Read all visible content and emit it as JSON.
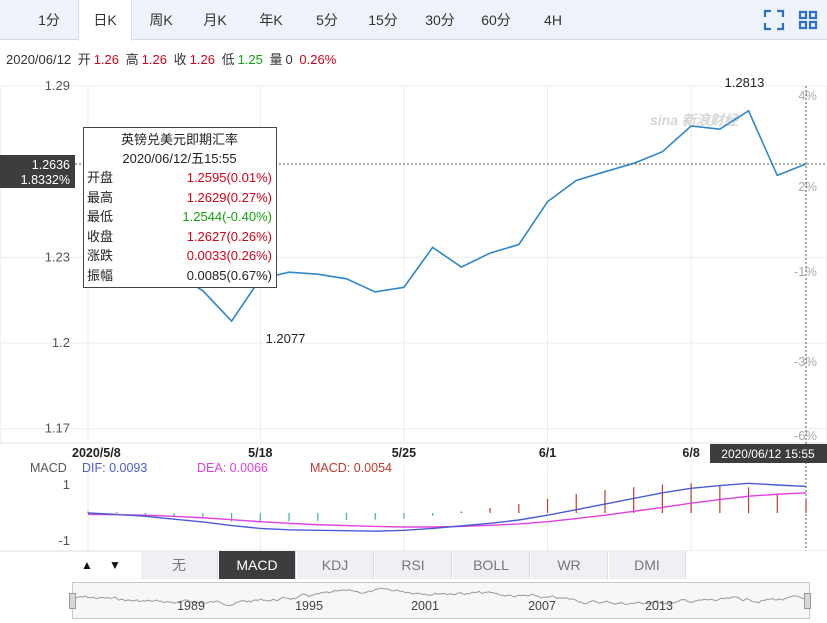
{
  "tabs": [
    "1分",
    "日K",
    "周K",
    "月K",
    "年K",
    "5分",
    "15分",
    "30分",
    "60分",
    "4H"
  ],
  "active_tab": 1,
  "tools": {
    "fullscreen_icon": "fullscreen-icon",
    "layout_icon": "grid-icon"
  },
  "quote": {
    "date": "2020/06/12",
    "open_label": "开",
    "open": "1.26",
    "high_label": "高",
    "high": "1.26",
    "close_label": "收",
    "close": "1.26",
    "low_label": "低",
    "low": "1.25",
    "volume_label": "量",
    "volume": "0",
    "change_pct": "0.26%"
  },
  "watermark": "sina 新浪财经",
  "tooltip": {
    "title": "英镑兑美元即期汇率",
    "datetime": "2020/06/12/五15:55",
    "rows": [
      {
        "label": "开盘",
        "value": "1.2595(0.01%)",
        "color": "red"
      },
      {
        "label": "最高",
        "value": "1.2629(0.27%)",
        "color": "red"
      },
      {
        "label": "最低",
        "value": "1.2544(-0.40%)",
        "color": "green"
      },
      {
        "label": "收盘",
        "value": "1.2627(0.26%)",
        "color": "red"
      },
      {
        "label": "涨跌",
        "value": "0.0033(0.26%)",
        "color": "red"
      },
      {
        "label": "振幅",
        "value": "0.0085(0.67%)",
        "color": "black"
      }
    ]
  },
  "crosshair": {
    "price": "1.2636",
    "pct": "1.8332%",
    "time": "2020/06/12 15:55"
  },
  "colors": {
    "line": "#2f86c8",
    "up": "#d0021b",
    "down": "#13a10e",
    "dif": "#4a5bd6",
    "dea": "#e040e0",
    "hist_up": "#c0392b",
    "hist_down": "#3cb4a0"
  },
  "macd_legend": {
    "name": "MACD",
    "dif": "DIF: 0.0093",
    "dea": "DEA: 0.0066",
    "macd": "MACD: 0.0054"
  },
  "indicator_tabs": [
    "无",
    "MACD",
    "KDJ",
    "RSI",
    "BOLL",
    "WR",
    "DMI"
  ],
  "active_indicator": 1,
  "navigator": {
    "years": [
      "1989",
      "1995",
      "2001",
      "2007",
      "2013"
    ]
  },
  "chart_data": {
    "type": "line",
    "title": "英镑兑美元即期汇率",
    "x_ticks": [
      "2020/5/8",
      "5/18",
      "5/25",
      "6/1",
      "6/8"
    ],
    "x": [
      "2020/05/08",
      "2020/05/11",
      "2020/05/12",
      "2020/05/13",
      "2020/05/14",
      "2020/05/15",
      "2020/05/18",
      "2020/05/19",
      "2020/05/20",
      "2020/05/21",
      "2020/05/22",
      "2020/05/25",
      "2020/05/26",
      "2020/05/27",
      "2020/05/28",
      "2020/05/29",
      "2020/06/01",
      "2020/06/02",
      "2020/06/03",
      "2020/06/04",
      "2020/06/05",
      "2020/06/08",
      "2020/06/09",
      "2020/06/10",
      "2020/06/11",
      "2020/06/12"
    ],
    "series": [
      {
        "values": [
          1.2404,
          1.233,
          1.2305,
          1.2245,
          1.2183,
          1.2077,
          1.2225,
          1.2248,
          1.2241,
          1.2225,
          1.2179,
          1.2195,
          1.2335,
          1.2266,
          1.2315,
          1.2345,
          1.2495,
          1.2569,
          1.26,
          1.2629,
          1.267,
          1.276,
          1.2749,
          1.2813,
          1.2587,
          1.2627
        ]
      }
    ],
    "y_ticks": [
      1.29,
      1.23,
      1.2,
      1.17
    ],
    "y_pct_ticks": [
      "4%",
      "2%",
      "-1%",
      "-3%",
      "-6%"
    ],
    "ylim": [
      1.165,
      1.29
    ],
    "annotations": [
      {
        "label": "1.2813"
      },
      {
        "label": "1.2077"
      }
    ],
    "macd": {
      "y_ticks": [
        "1",
        "-1"
      ],
      "dif": [
        0.0,
        -0.05,
        -0.12,
        -0.22,
        -0.32,
        -0.45,
        -0.55,
        -0.6,
        -0.62,
        -0.63,
        -0.65,
        -0.62,
        -0.55,
        -0.46,
        -0.37,
        -0.25,
        -0.08,
        0.12,
        0.32,
        0.52,
        0.72,
        0.88,
        0.98,
        1.06,
        1.0,
        0.95
      ],
      "dea": [
        -0.05,
        -0.06,
        -0.08,
        -0.12,
        -0.17,
        -0.24,
        -0.31,
        -0.37,
        -0.42,
        -0.45,
        -0.48,
        -0.5,
        -0.5,
        -0.48,
        -0.44,
        -0.39,
        -0.31,
        -0.2,
        -0.08,
        0.06,
        0.2,
        0.35,
        0.48,
        0.6,
        0.67,
        0.72
      ],
      "hist": [
        0.05,
        0.03,
        -0.06,
        -0.14,
        -0.2,
        -0.3,
        -0.32,
        -0.3,
        -0.28,
        -0.25,
        -0.24,
        -0.19,
        -0.1,
        0.05,
        0.18,
        0.32,
        0.5,
        0.68,
        0.82,
        0.92,
        1.02,
        1.06,
        1.0,
        0.92,
        0.66,
        0.46
      ]
    }
  }
}
